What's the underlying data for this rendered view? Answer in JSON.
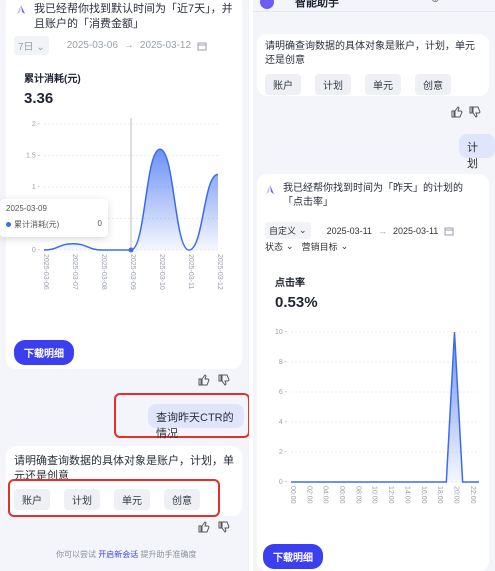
{
  "left": {
    "intro_text": "我已经帮你找到默认时间为「近7天」，并且账户的「消费金额」",
    "range_select": "7日",
    "date_start": "2025-03-06",
    "date_sep": "→",
    "date_end": "2025-03-12",
    "metric_title": "累计消耗(元)",
    "metric_value": "3.36",
    "tooltip": {
      "date": "2025-03-09",
      "series": "累计消耗(元)",
      "value": "0"
    },
    "download_label": "下载明细",
    "user_message": "查询昨天CTR的情况",
    "clarify_text": "请明确查询数据的具体对象是账户，计划，单元还是创意",
    "options": [
      "账户",
      "计划",
      "单元",
      "创意"
    ],
    "footer": {
      "prefix": "你可以尝试",
      "link": "开启新会话",
      "suffix": "提升助手准确度"
    }
  },
  "right": {
    "title": "智能助手",
    "clarify_text": "请明确查询数据的具体对象是账户，计划，单元还是创意",
    "options": [
      "账户",
      "计划",
      "单元",
      "创意"
    ],
    "user_message": "计划",
    "intro_text": "我已经帮你找到时间为「昨天」的计划的「点击率」",
    "range_select": "自定义",
    "date_start": "2025-03-11",
    "date_sep": "→",
    "date_end": "2025-03-11",
    "filter_status": "状态",
    "filter_goal": "营销目标",
    "metric_title": "点击率",
    "metric_value": "0.53%",
    "download_label": "下载明细"
  },
  "chart_data": [
    {
      "type": "area",
      "title": "累计消耗(元)",
      "x": [
        "2025-03-06",
        "2025-03-07",
        "2025-03-08",
        "2025-03-09",
        "2025-03-10",
        "2025-03-11",
        "2025-03-12"
      ],
      "series": [
        {
          "name": "累计消耗(元)",
          "values": [
            0,
            0.1,
            0,
            0,
            1.6,
            0,
            1.2
          ]
        }
      ],
      "yticks": [
        "0",
        "0.5",
        "1",
        "1.5",
        "2"
      ],
      "ylim": [
        0,
        2
      ],
      "color": "#3b6cf0"
    },
    {
      "type": "area",
      "title": "点击率",
      "x": [
        "00:00",
        "01:00",
        "02:00",
        "03:00",
        "04:00",
        "05:00",
        "06:00",
        "07:00",
        "08:00",
        "09:00",
        "10:00",
        "11:00",
        "12:00",
        "13:00",
        "14:00",
        "15:00",
        "16:00",
        "17:00",
        "18:00",
        "19:00",
        "20:00",
        "21:00",
        "22:00",
        "23:00"
      ],
      "xticks": [
        "00:00",
        "02:00",
        "04:00",
        "06:00",
        "08:00",
        "10:00",
        "12:00",
        "14:00",
        "16:00",
        "18:00",
        "20:00",
        "22:00"
      ],
      "series": [
        {
          "name": "点击率",
          "values": [
            0,
            0,
            0,
            0,
            0,
            0,
            0,
            0,
            0,
            0,
            0,
            0,
            0,
            0,
            0,
            0,
            0,
            0,
            0,
            0,
            10,
            0,
            0,
            0
          ]
        }
      ],
      "yticks": [
        "0",
        "2",
        "4",
        "6",
        "8",
        "10"
      ],
      "ylim": [
        0,
        10
      ],
      "color": "#3b6cf0"
    }
  ]
}
